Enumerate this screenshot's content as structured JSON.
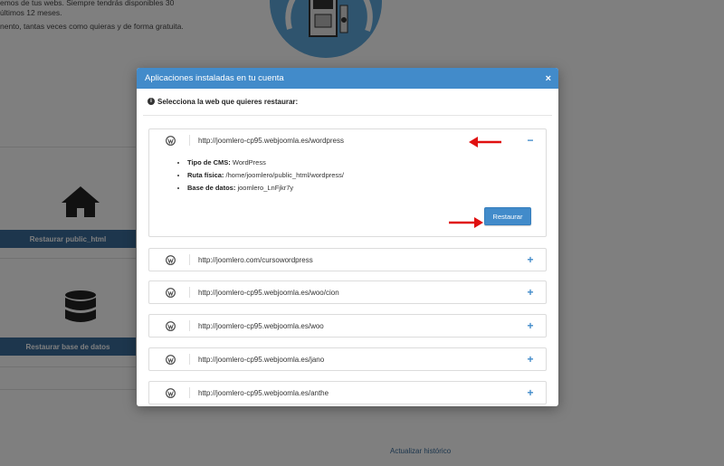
{
  "background": {
    "intro_lines": [
      "emos de tus webs. Siempre tendrás disponibles 30",
      "últimos 12 meses.",
      "nento, tantas veces como quieras y de forma gratuita."
    ],
    "restore_public_html_label": "Restaurar public_html",
    "restore_database_label": "Restaurar base de datos",
    "update_history_link": "Actualizar histórico"
  },
  "modal": {
    "title": "Aplicaciones instaladas en tu cuenta",
    "close_label": "×",
    "prompt": "Selecciona la web que quieres restaurar:",
    "info_icon": "i",
    "restore_button": "Restaurar",
    "sites": [
      {
        "url": "http://joomlero-cp95.webjoomla.es/wordpress",
        "toggle": "−",
        "expanded": true,
        "details": {
          "cms_label": "Tipo de CMS:",
          "cms_value": "WordPress",
          "path_label": "Ruta física:",
          "path_value": "/home/joomlero/public_html/wordpress/",
          "db_label": "Base de datos:",
          "db_value": "joomlero_LnFjkr7y"
        }
      },
      {
        "url": "http://joomlero.com/cursowordpress",
        "toggle": "+",
        "expanded": false
      },
      {
        "url": "http://joomlero-cp95.webjoomla.es/woo/cion",
        "toggle": "+",
        "expanded": false
      },
      {
        "url": "http://joomlero-cp95.webjoomla.es/woo",
        "toggle": "+",
        "expanded": false
      },
      {
        "url": "http://joomlero-cp95.webjoomla.es/jano",
        "toggle": "+",
        "expanded": false
      },
      {
        "url": "http://joomlero-cp95.webjoomla.es/anthe",
        "toggle": "+",
        "expanded": false
      }
    ]
  },
  "colors": {
    "accent": "#428bca",
    "overlay": "rgba(0,0,0,0.5)",
    "arrow": "#e01010"
  }
}
